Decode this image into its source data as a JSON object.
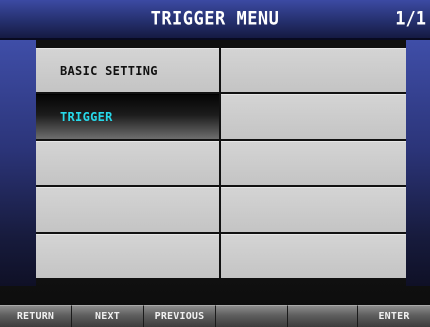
{
  "header": {
    "title": "TRIGGER MENU",
    "page": "1/1"
  },
  "menu": {
    "items": [
      {
        "label": "BASIC SETTING",
        "selected": false
      },
      {
        "label": "",
        "selected": false
      },
      {
        "label": "TRIGGER",
        "selected": true
      },
      {
        "label": "",
        "selected": false
      },
      {
        "label": "",
        "selected": false
      },
      {
        "label": "",
        "selected": false
      },
      {
        "label": "",
        "selected": false
      },
      {
        "label": "",
        "selected": false
      },
      {
        "label": "",
        "selected": false
      },
      {
        "label": "",
        "selected": false
      }
    ]
  },
  "footer": {
    "keys": [
      "RETURN",
      "NEXT",
      "PREVIOUS",
      "",
      "",
      "ENTER"
    ]
  },
  "colors": {
    "title_bar": "#25306e",
    "selected_text": "#27d9ea",
    "cell_bg": "#c8c8c8"
  }
}
